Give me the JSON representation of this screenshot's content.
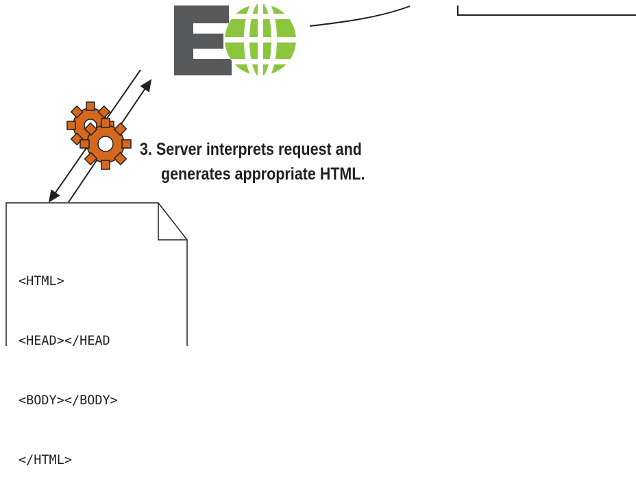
{
  "step": {
    "number": "3.",
    "line1": "Server interprets request and",
    "line2": "generates appropriate HTML."
  },
  "document": {
    "lines": [
      "<HTML>",
      "<HEAD></HEAD",
      "<BODY></BODY>",
      "</HTML>"
    ]
  },
  "icons": {
    "logo": "server-logo-icon",
    "gear": "gear-icon",
    "document": "html-document-icon"
  },
  "colors": {
    "globe_green": "#8cc63f",
    "logo_gray": "#58595b",
    "gear_orange": "#d2691e",
    "ink": "#231f20"
  }
}
